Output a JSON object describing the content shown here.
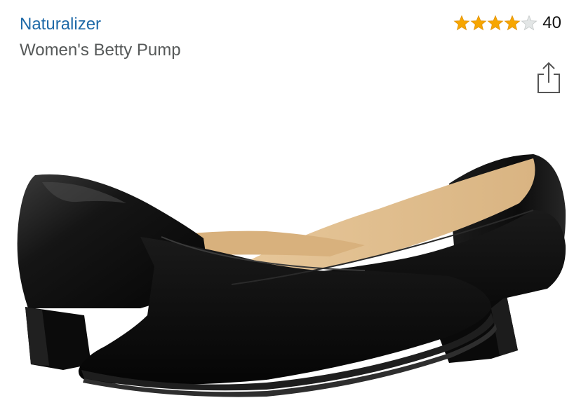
{
  "product": {
    "brand": "Naturalizer",
    "title": "Women's Betty Pump",
    "rating_value": 4,
    "rating_max": 5,
    "review_count": "40"
  },
  "icons": {
    "share": "share-icon",
    "star": "star-icon"
  },
  "colors": {
    "brand_link": "#1f6aa8",
    "title_text": "#565959",
    "star_filled": "#f7a600",
    "star_empty": "#d5d9d9"
  }
}
